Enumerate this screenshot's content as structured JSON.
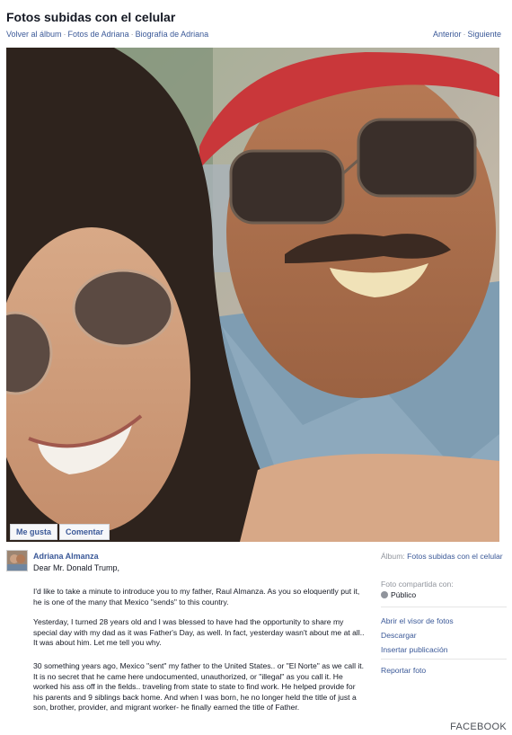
{
  "header": {
    "title": "Fotos subidas con el celular",
    "breadcrumb": [
      "Volver al álbum",
      "Fotos de Adriana",
      "Biografía de Adriana"
    ],
    "pager": {
      "prev": "Anterior",
      "next": "Siguiente"
    }
  },
  "photo_actions": {
    "like": "Me gusta",
    "comment": "Comentar"
  },
  "post": {
    "author": "Adriana Almanza",
    "greeting": "Dear Mr. Donald Trump,",
    "paragraphs": [
      "I'd like to take a minute to introduce you to my father, Raul Almanza. As you so eloquently put it, he is one of the many that Mexico \"sends\" to this country.",
      "Yesterday, I turned 28 years old and I was blessed to have had the opportunity to share my special day with my dad as it was Father's Day, as well. In fact, yesterday wasn't about me at all.. It was about him. Let me tell you why.",
      "30 something years ago, Mexico \"sent\" my father to the United States.. or \"El Norte\" as we call it. It is no secret that he came here undocumented, unauthorized, or \"illegal\" as you call it. He worked his ass off in the fields.. traveling from state to state to find work. He helped provide for his parents and 9 siblings back home. And when I was born, he no longer held the title of just a son, brother, provider, and migrant worker- he finally earned the title of Father."
    ]
  },
  "sidebar": {
    "album_label": "Álbum:",
    "album_name": "Fotos subidas con el celular",
    "shared_with_label": "Foto compartida con:",
    "shared_with_value": "Público",
    "links": [
      "Abrir el visor de fotos",
      "Descargar",
      "Insertar publicación"
    ],
    "report": "Reportar foto"
  },
  "footer": {
    "credit": "FACEBOOK"
  },
  "colors": {
    "link": "#3b5998",
    "muted": "#90949c",
    "text": "#141823"
  }
}
